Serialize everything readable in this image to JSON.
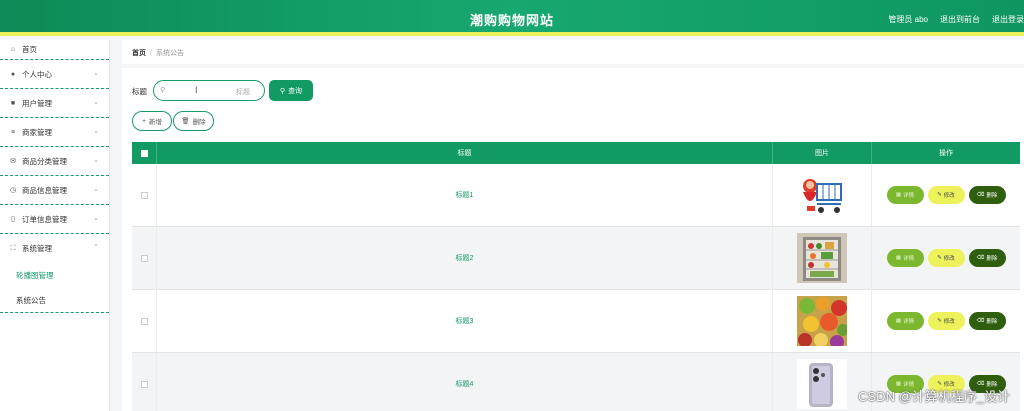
{
  "header": {
    "title": "潮购购物网站",
    "admin": "管理员 abo",
    "back_to_front": "退出到前台",
    "logout": "退出登录"
  },
  "sidebar": {
    "home": "首页",
    "items": [
      {
        "label": "个人中心",
        "icon": "user-icon"
      },
      {
        "label": "用户管理",
        "icon": "users-icon"
      },
      {
        "label": "商家管理",
        "icon": "list-icon"
      },
      {
        "label": "商品分类管理",
        "icon": "mail-icon"
      },
      {
        "label": "商品信息管理",
        "icon": "gauge-icon"
      },
      {
        "label": "订单信息管理",
        "icon": "lock-icon"
      },
      {
        "label": "系统管理",
        "icon": "expand-icon"
      }
    ],
    "sub_items": [
      "轮播图管理",
      "系统公告"
    ]
  },
  "breadcrumb": {
    "home": "首页",
    "current": "系统公告"
  },
  "search": {
    "label": "标题",
    "placeholder": "标题",
    "button": "查询"
  },
  "actions": {
    "add": "新增",
    "delete": "删除"
  },
  "table": {
    "headers": {
      "title": "标题",
      "image": "图片",
      "ops": "操作"
    },
    "rows": [
      {
        "title": "标题1",
        "image": "shopping-cart-mascot"
      },
      {
        "title": "标题2",
        "image": "fridge-produce"
      },
      {
        "title": "标题3",
        "image": "fruit-assortment"
      },
      {
        "title": "标题4",
        "image": "phone-product"
      }
    ],
    "op_labels": {
      "detail": "详情",
      "edit": "修改",
      "delete": "删除"
    }
  },
  "watermark": "CSDN @计算机程序_设计",
  "colors": {
    "primary": "#129a63",
    "accent": "#e9f25a",
    "detail": "#7cb82f",
    "edit": "#eef25a",
    "danger": "#2f5e0e"
  }
}
